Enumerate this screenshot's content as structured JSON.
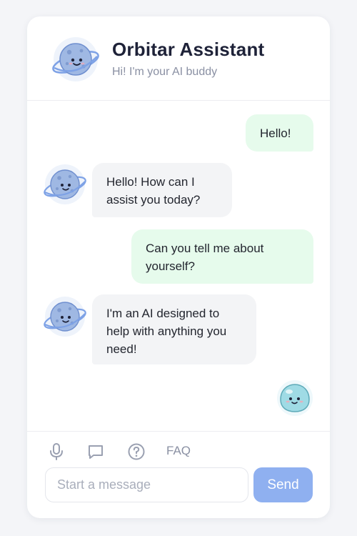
{
  "header": {
    "title": "Orbitar Assistant",
    "subtitle": "Hi! I'm your AI buddy",
    "avatar_icon": "planet-mascot-icon"
  },
  "messages": [
    {
      "sender": "user",
      "text": "Hello!"
    },
    {
      "sender": "bot",
      "text": "Hello! How can I assist you today?"
    },
    {
      "sender": "user",
      "text": "Can you tell me about yourself?"
    },
    {
      "sender": "bot",
      "text": "I'm an AI designed to help with anything you need!"
    }
  ],
  "toolbar": {
    "icons": [
      "microphone-icon",
      "chat-bubble-icon",
      "help-circle-icon"
    ],
    "faq_label": "FAQ"
  },
  "composer": {
    "placeholder": "Start a message",
    "value": "",
    "send_label": "Send"
  },
  "colors": {
    "user_bubble": "#e6fbec",
    "bot_bubble": "#f3f4f6",
    "send_button": "#8fb0f0",
    "title": "#1e2238"
  }
}
